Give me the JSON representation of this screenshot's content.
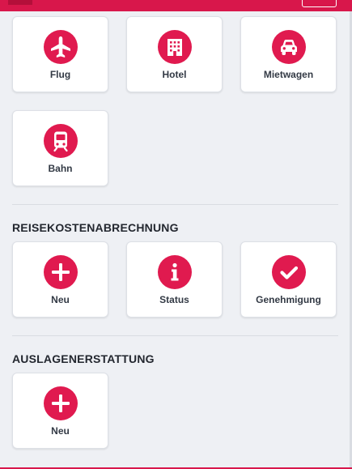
{
  "theme": {
    "accent": "#e01a4f",
    "header": "#d8174b"
  },
  "travel": {
    "tiles": [
      {
        "label": "Flug",
        "icon": "airplane-icon"
      },
      {
        "label": "Hotel",
        "icon": "hotel-building-icon"
      },
      {
        "label": "Mietwagen",
        "icon": "car-icon"
      },
      {
        "label": "Bahn",
        "icon": "train-icon"
      }
    ]
  },
  "expense_report": {
    "title": "REISEKOSTENABRECHNUNG",
    "tiles": [
      {
        "label": "Neu",
        "icon": "plus-icon"
      },
      {
        "label": "Status",
        "icon": "info-icon"
      },
      {
        "label": "Genehmigung",
        "icon": "checkmark-icon"
      }
    ]
  },
  "reimbursement": {
    "title": "AUSLAGENERSTATTUNG",
    "tiles": [
      {
        "label": "Neu",
        "icon": "plus-icon"
      }
    ]
  }
}
